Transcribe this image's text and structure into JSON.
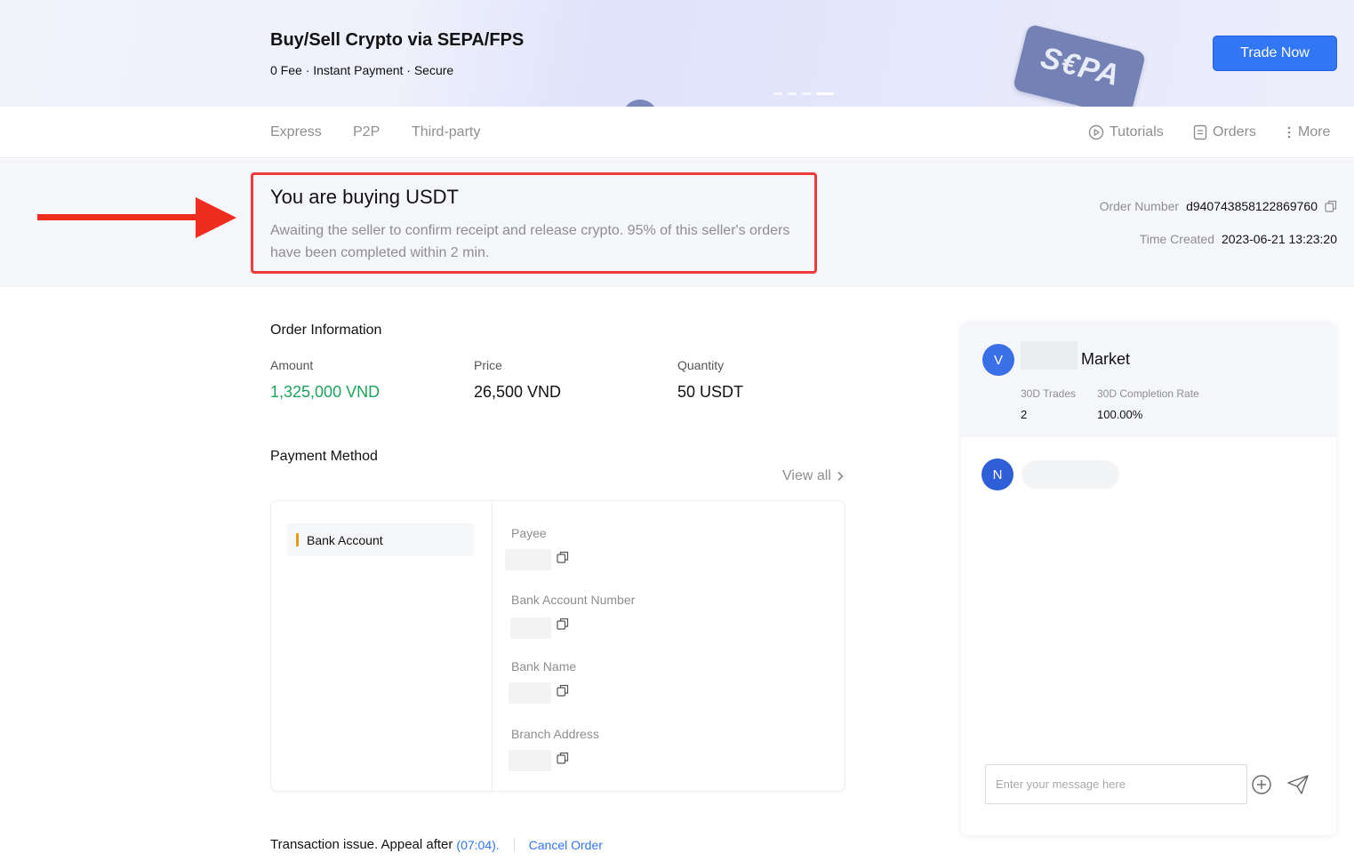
{
  "banner": {
    "title": "Buy/Sell Crypto via SEPA/FPS",
    "subtitle": "0 Fee · Instant Payment · Secure",
    "badge_text": "S€PA",
    "cta_label": "Trade Now",
    "accent": "#3176f5"
  },
  "nav": {
    "tabs": [
      {
        "label": "Express"
      },
      {
        "label": "P2P"
      },
      {
        "label": "Third-party"
      }
    ],
    "right": {
      "tutorials": "Tutorials",
      "orders": "Orders",
      "more": "More"
    }
  },
  "status": {
    "title": "You are buying USDT",
    "description": "Awaiting the seller to confirm receipt and release crypto. 95% of this seller's orders have been completed within 2 min.",
    "order_number_label": "Order Number",
    "order_number": "d940743858122869760",
    "time_created_label": "Time Created",
    "time_created": "2023-06-21 13:23:20",
    "highlight_color": "#ee3b3b"
  },
  "order": {
    "section_title": "Order Information",
    "amount_label": "Amount",
    "amount": "1,325,000 VND",
    "price_label": "Price",
    "price": "26,500 VND",
    "quantity_label": "Quantity",
    "quantity": "50 USDT"
  },
  "payment": {
    "section_title": "Payment Method",
    "view_all": "View all",
    "method_tab": "Bank Account",
    "fields": [
      {
        "label": "Payee"
      },
      {
        "label": "Bank Account Number"
      },
      {
        "label": "Bank Name"
      },
      {
        "label": "Branch Address"
      }
    ]
  },
  "footer": {
    "issue_text": "Transaction issue. Appeal after",
    "timer": "(07:04).",
    "cancel": "Cancel Order"
  },
  "chat": {
    "merchant_initial": "V",
    "merchant_name": "Market",
    "trades_label": "30D Trades",
    "trades_value": "2",
    "completion_label": "30D Completion Rate",
    "completion_value": "100.00%",
    "user_initial": "N",
    "input_placeholder": "Enter your message here"
  }
}
